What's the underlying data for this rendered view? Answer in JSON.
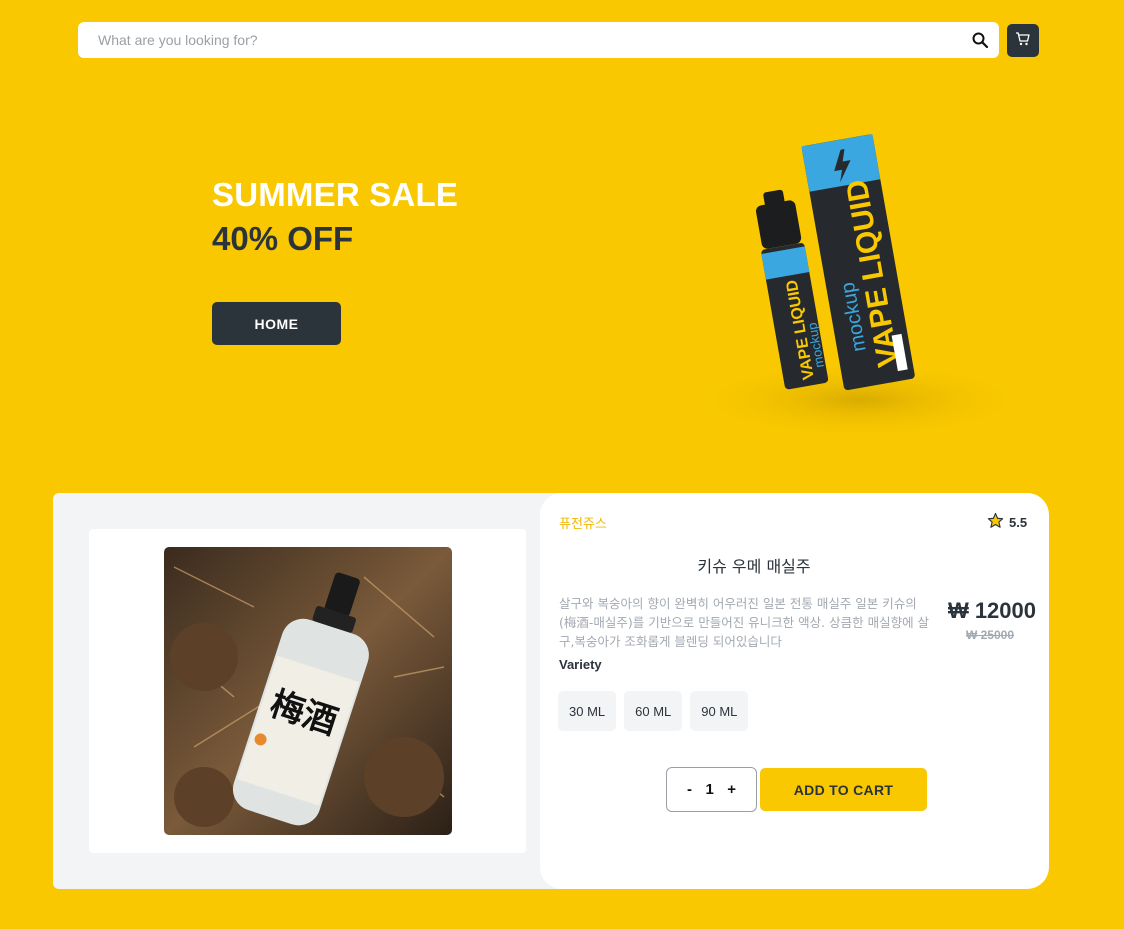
{
  "search": {
    "placeholder": "What are you looking for?",
    "icon": "search-icon"
  },
  "header": {
    "cart_icon": "cart-icon"
  },
  "hero": {
    "title": "SUMMER SALE",
    "subtitle": "40% OFF",
    "button_label": "HOME",
    "image": {
      "box_label": "VAPE LIQUID",
      "box_sub": "mockup",
      "bottle_label": "VAPE LIQUID",
      "bottle_sub": "mockup"
    }
  },
  "product": {
    "brand": "퓨전쥬스",
    "rating": "5.5",
    "name": "키슈 우메 매실주",
    "description": "살구와 복숭아의 향이 완벽히 어우러진 일본 전통 매실주 일본 키슈의 (梅酒-매실주)를 기반으로 만들어진 유니크한 액상. 상큼한 매실향에 살구,복숭아가 조화롭게 블렌딩 되어있습니다",
    "price": "₩ 12000",
    "old_price": "₩ 25000",
    "variety_label": "Variety",
    "variants": [
      "30 ML",
      "60 ML",
      "90 ML"
    ],
    "quantity": {
      "minus": "-",
      "value": "1",
      "plus": "+"
    },
    "add_to_cart": "ADD TO CART",
    "image_text": "梅酒"
  },
  "colors": {
    "background": "#f9c800",
    "dark": "#2b333b",
    "accent": "#f2b705",
    "muted": "#a3a9b1"
  }
}
